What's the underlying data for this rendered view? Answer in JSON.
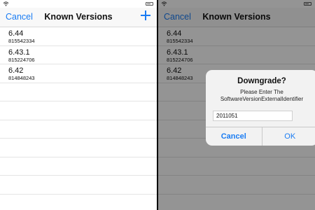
{
  "left": {
    "nav": {
      "cancel": "Cancel",
      "title": "Known Versions"
    },
    "versions": [
      {
        "version": "6.44",
        "id": "815542334"
      },
      {
        "version": "6.43.1",
        "id": "815224706"
      },
      {
        "version": "6.42",
        "id": "814848243"
      }
    ]
  },
  "right": {
    "nav": {
      "cancel": "Cancel",
      "title": "Known Versions"
    },
    "versions": [
      {
        "version": "6.44",
        "id": "815542334"
      },
      {
        "version": "6.43.1",
        "id": "815224706"
      },
      {
        "version": "6.42",
        "id": "814848243"
      }
    ],
    "alert": {
      "title": "Downgrade?",
      "message_line1": "Please Enter The",
      "message_line2": "SoftwareVersionExternalIdentifier",
      "input_value": "2011051",
      "cancel": "Cancel",
      "ok": "OK"
    }
  },
  "icons": {
    "status": "wifi-icon",
    "battery": "battery-icon",
    "add": "add-icon"
  },
  "colors": {
    "accent": "#1a7cf3",
    "nav_background": "#f8f8f8"
  }
}
